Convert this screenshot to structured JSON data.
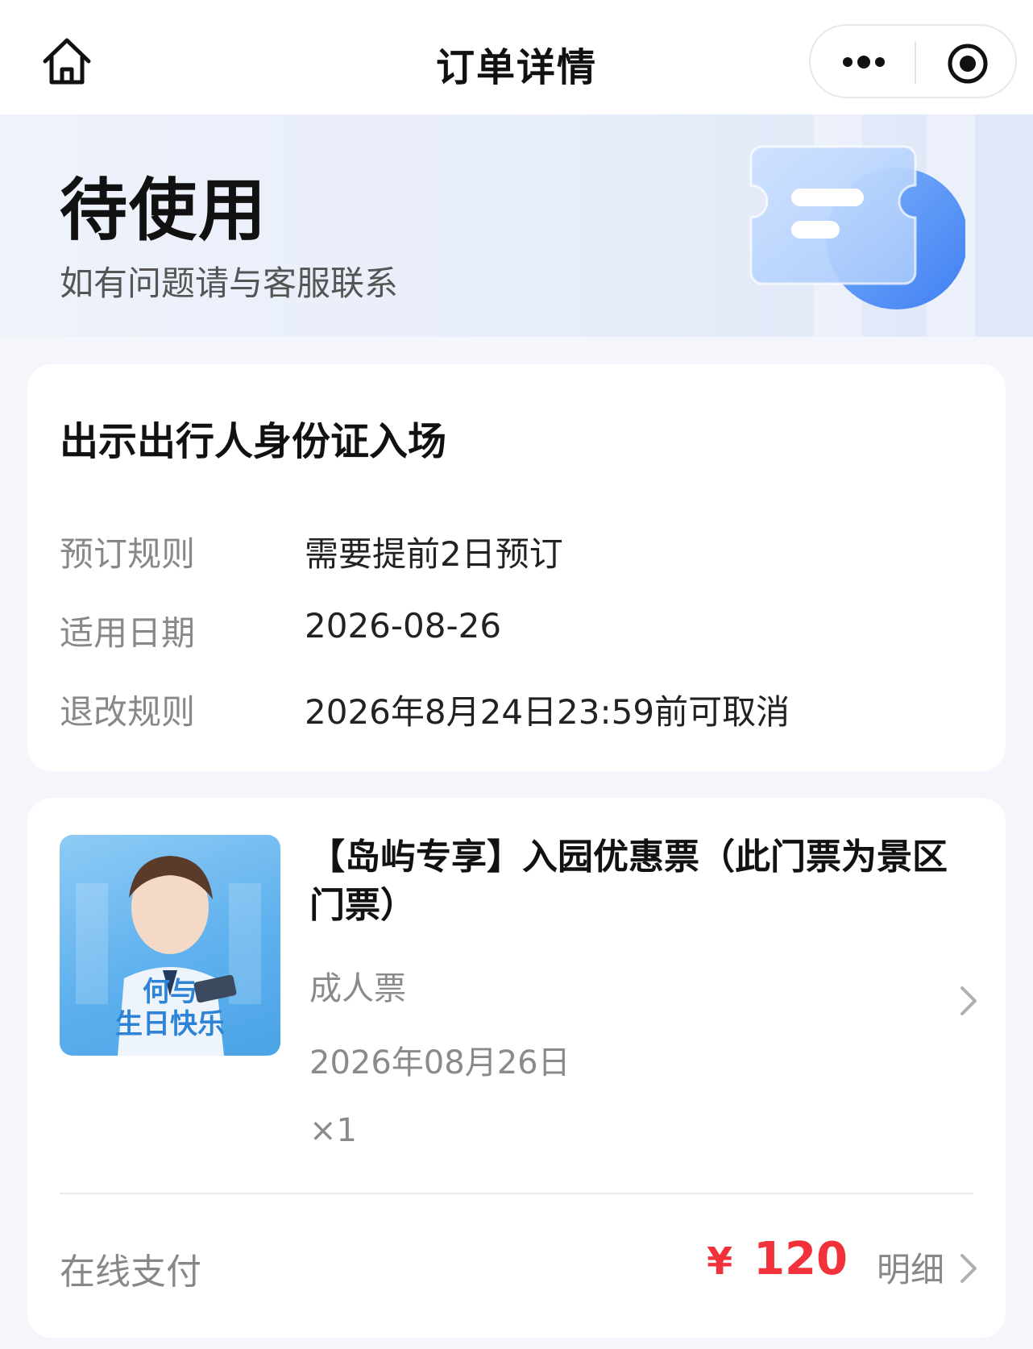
{
  "nav": {
    "title": "订单详情",
    "home_icon": "home-icon",
    "more_icon": "more-dots-icon",
    "close_icon": "target-circle-icon"
  },
  "status": {
    "title": "待使用",
    "subtitle": "如有问题请与客服联系"
  },
  "entry_info": {
    "heading": "出示出行人身份证入场",
    "rows": [
      {
        "label": "预订规则",
        "value": "需要提前2日预订"
      },
      {
        "label": "适用日期",
        "value": "2026-08-26"
      },
      {
        "label": "退改规则",
        "value": "2026年8月24日23:59前可取消"
      }
    ]
  },
  "product": {
    "title": "【岛屿专享】入园优惠票（此门票为景区门票）",
    "ticket_type": "成人票",
    "date": "2026年08月26日",
    "quantity": "×1",
    "image_text": "何与\n生日快乐"
  },
  "payment": {
    "label": "在线支付",
    "currency": "¥",
    "amount": "120",
    "detail_label": "明细"
  },
  "colors": {
    "accent_price": "#f2323b",
    "banner_bg": "#e7edf9",
    "ticket_blue": "#4f8ff5"
  }
}
